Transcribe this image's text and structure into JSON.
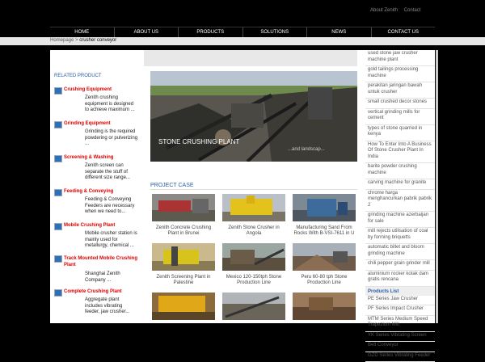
{
  "top_links": [
    "About Zenith",
    "Contact"
  ],
  "nav": [
    "HOME",
    "ABOUT US",
    "PRODUCTS",
    "SOLUTIONS",
    "NEWS",
    "CONTACT US"
  ],
  "breadcrumb": {
    "home": "Homepage",
    "sep": ">",
    "current": "crusher conveyor"
  },
  "related": {
    "title": "RELATED PRODUCT",
    "items": [
      {
        "title": "Crushing Equipment",
        "desc": "Zenith crushing equipment is designed to achieve maximum ..."
      },
      {
        "title": "Grinding Equipment",
        "desc": "Grinding is the required powdering or pulverizing ..."
      },
      {
        "title": "Screening & Washing",
        "desc": "Zenith screen can separate the stuff of different size range..."
      },
      {
        "title": "Feeding & Conveying",
        "desc": "Feeding & Conveying Feeders are necessary when we need to..."
      },
      {
        "title": "Mobile Crushing Plant",
        "desc": "Mobile crusher station is mainly used for metallurgy, chemical ..."
      },
      {
        "title": "Track Mounted Mobile Crushing Plant",
        "desc": "Shanghai Zenith Company ..."
      },
      {
        "title": "Complete Crushing Plant",
        "desc": "Aggregate plant includes vibrating feeder, jaw crusher..."
      }
    ]
  },
  "hero": {
    "caption": "STONE CRUSHING PLANT",
    "sub": "...and landscap..."
  },
  "project_case": {
    "title": "PROJECT CASE",
    "items": [
      "Zenith Concrete Crushing Plant in Brunei",
      "Zenith Stone Crusher in Angola",
      "Manufacturing Sand From Rocks With B-VSI-7611 in U",
      "Zenith Screening Plant in Palestine",
      "Mexico 120-150tph Stone Production Line",
      "Peru 60-80 tph Stone Production Line",
      "",
      "",
      ""
    ]
  },
  "right_links": [
    "used stone jaw crusher machine plant",
    "gold tailings processing machine",
    "perakitan jaringan bawah untuk crusher",
    "small crushed decor stones",
    "vertical grinding mills for cement",
    "types of stone quarried in kenya",
    "How To Enter Into A Business Of Stone Crusher Plant In India",
    "barite powder crushing machine",
    "carving machine for granite",
    "chrome harga menghancurkan pabrik pabrik 2",
    "grinding machine azerbaijan for sale",
    "mill rejects utilisation of coal by forming briquetts",
    "automatic billet and bloom grinding machine",
    "chili pepper grain grinder mill",
    "aluminium rocker kotak dam gratis rencana"
  ],
  "products": {
    "title": "Products List",
    "items": [
      "PE Series Jaw Crusher",
      "PF Series Impact Crusher",
      "MTM Series Medium Speed Trapezium Mill",
      "YK Series Vibrating Screen",
      "Belt Conveyor",
      "GZD Series Vibrating Feeder"
    ]
  }
}
